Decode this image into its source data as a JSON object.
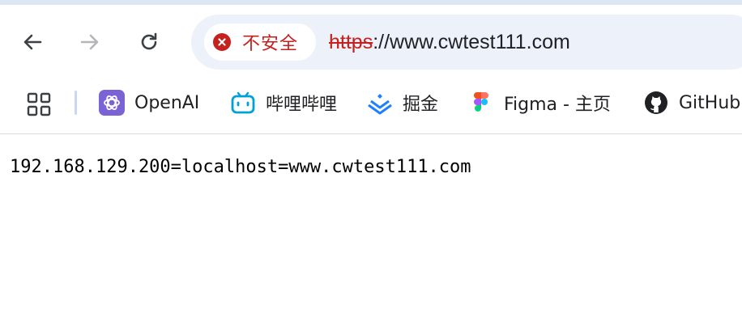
{
  "toolbar": {
    "back_icon": "arrow-left-icon",
    "forward_icon": "arrow-right-icon",
    "reload_icon": "reload-icon"
  },
  "omnibox": {
    "security_label": "不安全",
    "security_icon": "warning-x-icon",
    "scheme": "https",
    "url_rest": "://www.cwtest111.com"
  },
  "bookmarks": {
    "apps_icon": "apps-grid-icon",
    "items": [
      {
        "label": "OpenAI",
        "icon": "openai-icon"
      },
      {
        "label": "哔哩哔哩",
        "icon": "bilibili-icon"
      },
      {
        "label": "掘金",
        "icon": "juejin-icon"
      },
      {
        "label": "Figma - 主页",
        "icon": "figma-icon"
      },
      {
        "label": "GitHub",
        "icon": "github-icon"
      }
    ]
  },
  "page": {
    "text": "192.168.129.200=localhost=www.cwtest111.com"
  },
  "colors": {
    "warning_red": "#c5221f",
    "omnibox_bg": "#edf1f9",
    "openai_purple": "#7b63d6",
    "bilibili_blue": "#00a1d6",
    "juejin_blue": "#1e80ff"
  }
}
